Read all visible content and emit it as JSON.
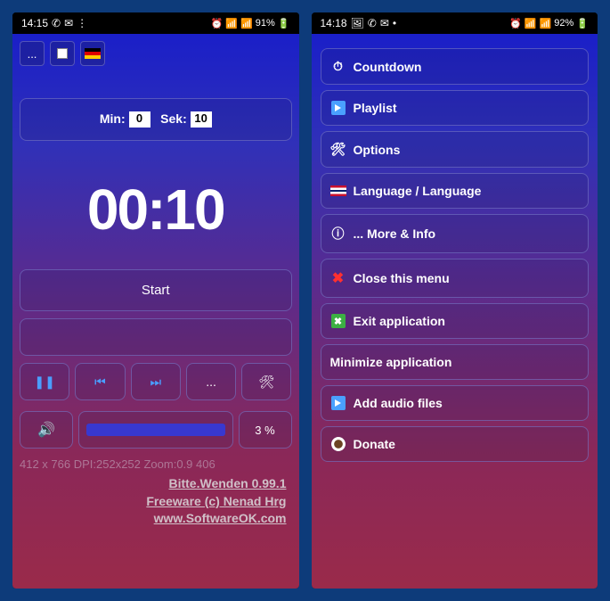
{
  "left": {
    "status": {
      "time": "14:15",
      "battery": "91%"
    },
    "setup": {
      "min_label": "Min:",
      "min_value": "0",
      "sek_label": "Sek:",
      "sek_value": "10"
    },
    "big_time": "00:10",
    "start_label": "Start",
    "dots": "...",
    "volume_pct": "3 %",
    "debug": "412 x 766 DPI:252x252 Zoom:0.9 406",
    "footer": {
      "l1": "Bitte.Wenden 0.99.1",
      "l2": "Freeware (c) Nenad Hrg",
      "l3": "www.SoftwareOK.com"
    }
  },
  "right": {
    "status": {
      "time": "14:18",
      "battery": "92%"
    },
    "menu": {
      "countdown": "Countdown",
      "playlist": "Playlist",
      "options": "Options",
      "language": "Language / Language",
      "more": "... More & Info",
      "close": "Close this menu",
      "exit": "Exit application",
      "minimize": "Minimize application",
      "add_audio": "Add audio files",
      "donate": "Donate"
    }
  }
}
